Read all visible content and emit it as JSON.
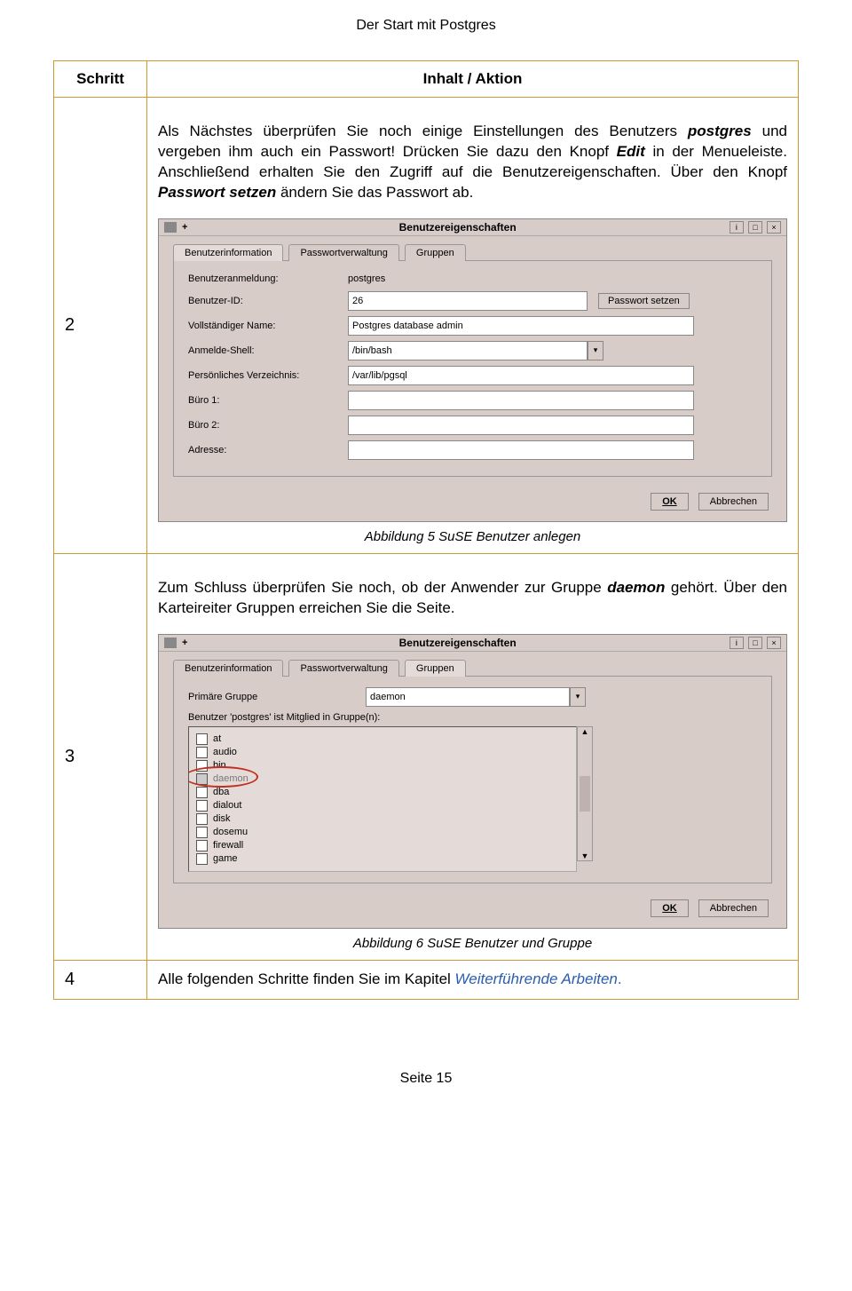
{
  "doc_title": "Der Start mit Postgres",
  "headers": {
    "schritt": "Schritt",
    "inhalt": "Inhalt / Aktion"
  },
  "row2": {
    "num": "2",
    "text_pre": "Als Nächstes überprüfen Sie noch einige Einstellungen des Benutzers ",
    "text_postgres": "postgres",
    "text_mid1": " und vergeben ihm auch ein Passwort! Drücken Sie dazu den Knopf ",
    "text_edit": "Edit",
    "text_mid2": " in der Menueleiste. Anschließend erhalten Sie den Zugriff auf die Benutzereigenschaften. Über den Knopf ",
    "text_pwset": "Passwort setzen",
    "text_end": " ändern Sie das Passwort ab.",
    "caption": "Abbildung 5 SuSE Benutzer anlegen"
  },
  "row3": {
    "num": "3",
    "text_pre": "Zum Schluss überprüfen Sie noch, ob der Anwender zur Gruppe ",
    "text_daemon": "daemon",
    "text_end": " gehört. Über den Karteireiter Gruppen erreichen Sie die Seite.",
    "caption": "Abbildung 6 SuSE Benutzer und Gruppe"
  },
  "row4": {
    "num": "4",
    "text_pre": "Alle folgenden Schritte finden Sie im Kapitel ",
    "text_link": "Weiterführende Arbeiten",
    "text_end": "."
  },
  "scr1": {
    "title": "Benutzereigenschaften",
    "tabs": [
      "Benutzerinformation",
      "Passwortverwaltung",
      "Gruppen"
    ],
    "labels": {
      "anmeldung": "Benutzeranmeldung:",
      "id": "Benutzer-ID:",
      "vollname": "Vollständiger Name:",
      "shell": "Anmelde-Shell:",
      "home": "Persönliches Verzeichnis:",
      "buero1": "Büro 1:",
      "buero2": "Büro 2:",
      "adresse": "Adresse:"
    },
    "values": {
      "anmeldung": "postgres",
      "id": "26",
      "vollname": "Postgres database admin",
      "shell": "/bin/bash",
      "home": "/var/lib/pgsql",
      "buero1": "",
      "buero2": "",
      "adresse": ""
    },
    "pwbtn": "Passwort setzen",
    "ok": "OK",
    "cancel": "Abbrechen"
  },
  "scr2": {
    "title": "Benutzereigenschaften",
    "tabs": [
      "Benutzerinformation",
      "Passwortverwaltung",
      "Gruppen"
    ],
    "primgrp_label": "Primäre Gruppe",
    "primgrp_value": "daemon",
    "memberlabel": "Benutzer 'postgres' ist Mitglied in Gruppe(n):",
    "groups": [
      "at",
      "audio",
      "bin",
      "daemon",
      "dba",
      "dialout",
      "disk",
      "dosemu",
      "firewall",
      "game"
    ],
    "ok": "OK",
    "cancel": "Abbrechen"
  },
  "footer": "Seite 15"
}
